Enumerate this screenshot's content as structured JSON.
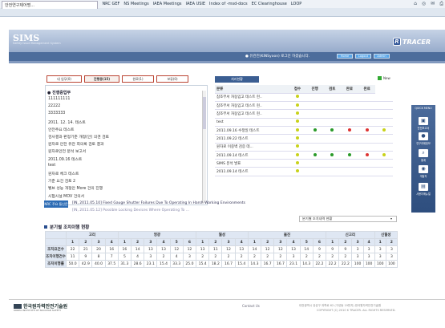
{
  "favorites": [
    "국내외 법규제입..",
    "MEXIS",
    "ANS",
    "KINS",
    "NRC",
    "PNU",
    "NRC GEF",
    "NS Meetings",
    "IAEA Meetings",
    "IAEA USIE",
    "Index of -msd-docs",
    "EC Clearinghouse",
    "LOOP"
  ],
  "tab_title": "안전연구제어명...",
  "header": {
    "logo": "SIMS",
    "logo_sub": "Safety Issue Management System",
    "brand": "TRACER",
    "welcome": "● 유관진(KINSyoon) 로그인 하셨습니다.",
    "buttons": [
      "Home",
      "Logout",
      "Admin"
    ]
  },
  "todo_tabs": [
    {
      "label": "내 업무(0)",
      "active": false
    },
    {
      "label": "진행중(15)",
      "active": true
    },
    {
      "label": "완료(1)",
      "active": false
    },
    {
      "label": "보류(0)",
      "active": false
    }
  ],
  "todo_title": "● 진행중업무",
  "todo_items": [
    "111111111",
    "22222",
    "3333333",
    "2011. 12. 14. 테스트",
    "안전주요 테스트",
    "검사결과 판정기준 개정(안) 의견 검토",
    "원자로 안전 유관 회의록 검토 결과",
    "원자로안전 분석 보고서",
    "2011.09.16 테스트",
    "test",
    "원자로 체크 테스트",
    "기준 요건 검토 2",
    "벨브 성능 개정안 More 건의 진행",
    "시험시설 MOV 건의서"
  ],
  "proc_head": "처리현황",
  "new_label": "New",
  "proc_columns": [
    "분류",
    "접수",
    "진행",
    "검토",
    "완료",
    "완료"
  ],
  "proc_rows": [
    {
      "name": "참조부서 자동입고 테스트 현..",
      "s": [
        "y",
        "",
        "",
        "",
        "",
        ""
      ]
    },
    {
      "name": "참조부서 자동입고 테스트 현..",
      "s": [
        "y",
        "",
        "",
        "",
        "",
        ""
      ]
    },
    {
      "name": "참조부서 자동입고 테스트 현..",
      "s": [
        "y",
        "",
        "",
        "",
        "",
        ""
      ]
    },
    {
      "name": "test",
      "s": [
        "y",
        "",
        "",
        "",
        "",
        ""
      ]
    },
    {
      "name": "2011.09.16 수정일 테스트",
      "s": [
        "y",
        "g",
        "g",
        "r",
        "r",
        "y"
      ]
    },
    {
      "name": "2011.09.22 테스트",
      "s": [
        "y",
        "",
        "",
        "",
        "",
        ""
      ]
    },
    {
      "name": "원자로 이중벽 검증 데...",
      "s": [
        "y",
        "",
        "",
        "",
        "",
        ""
      ]
    },
    {
      "name": "2011.09.14 테스트",
      "s": [
        "y",
        "g",
        "g",
        "g",
        "r",
        "y"
      ]
    },
    {
      "name": "SIMS 분석 발표",
      "s": [
        "y",
        "",
        "",
        "",
        "",
        ""
      ]
    },
    {
      "name": "2011.09.14 테스트",
      "s": [
        "y",
        "",
        "",
        "",
        "",
        ""
      ]
    }
  ],
  "quick_menu": {
    "title": "QUICK MENU",
    "items": [
      "안전보고서",
      "연구과제정보",
      "통계",
      "개발자",
      "사용자매뉴얼"
    ]
  },
  "news": {
    "badge": "NRC 주요 통신문",
    "line1": "[IN, 2011.05.10] Fixed Gauge Shutter Failures Due To Operating In Harsh Working Environments",
    "line2": "[IN, 2011.05.12] Possible Locking Devices Where Operating To ..."
  },
  "stat": {
    "select": "분기별 조치내역 현황",
    "title": "분기별 조치이행 현황",
    "groups": [
      "고리",
      "영광",
      "월성",
      "울진",
      "신고리",
      "신월성"
    ],
    "quarters": [
      "1",
      "2",
      "3",
      "4",
      "1",
      "2",
      "3",
      "4",
      "5",
      "6",
      "1",
      "2",
      "3",
      "4",
      "1",
      "2",
      "3",
      "4",
      "5",
      "6",
      "1",
      "2",
      "3",
      "4",
      "1",
      "2"
    ],
    "rows": [
      {
        "label": "조치요건수",
        "values": [
          "22",
          "21",
          "20",
          "16",
          "16",
          "14",
          "13",
          "13",
          "12",
          "12",
          "13",
          "11",
          "12",
          "13",
          "14",
          "12",
          "12",
          "13",
          "14",
          "9",
          "9",
          "9",
          "3",
          "3",
          "3",
          "3"
        ]
      },
      {
        "label": "조치이행건수",
        "values": [
          "11",
          "9",
          "8",
          "7",
          "5",
          "4",
          "3",
          "2",
          "4",
          "3",
          "2",
          "2",
          "2",
          "2",
          "2",
          "2",
          "2",
          "3",
          "2",
          "2",
          "2",
          "2",
          "3",
          "3",
          "3",
          "3"
        ]
      },
      {
        "label": "조치이행률",
        "values": [
          "50.0",
          "42.9",
          "40.0",
          "37.5",
          "31.3",
          "28.6",
          "23.1",
          "15.4",
          "33.3",
          "25.0",
          "15.4",
          "18.2",
          "16.7",
          "15.4",
          "14.3",
          "16.7",
          "16.7",
          "23.1",
          "14.3",
          "22.2",
          "22.2",
          "22.2",
          "100",
          "100",
          "100",
          "100"
        ]
      }
    ]
  },
  "footer": {
    "logo": "한국원자력안전기술원",
    "logo_sub": "KOREA INSTITUTE OF NUCLEAR SAFETY",
    "contact": "Contact Us",
    "address": "대전광역시 유성구 과학로 62 (구성동 19번지) 한국원자력안전기술원",
    "copyright": "COPYRIGHT (C) 2010 K TRACER. ALL RIGHTS RESERVED."
  },
  "colors": {
    "nav": "#4d6d9c",
    "accent": "#3b5e92"
  }
}
